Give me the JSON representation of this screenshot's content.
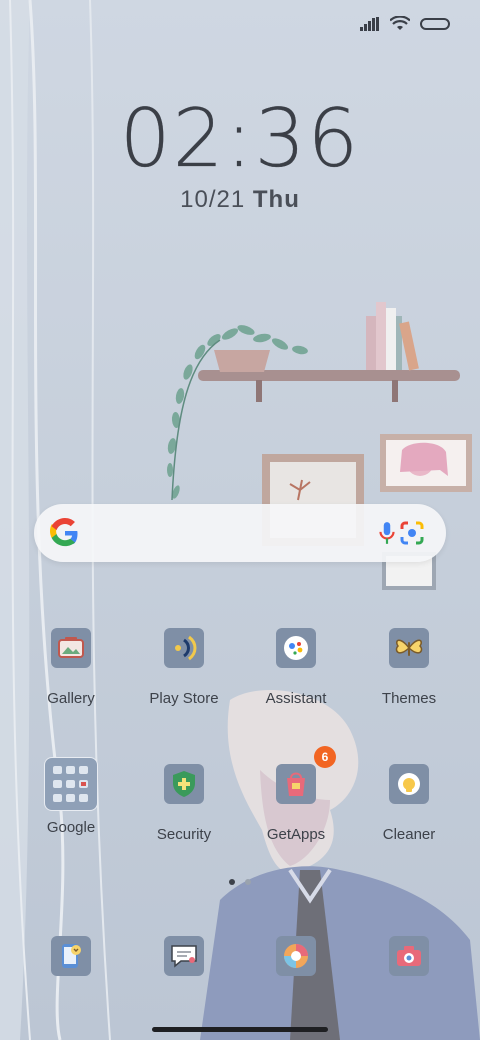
{
  "status_bar": {
    "icons": [
      "signal-icon",
      "wifi-icon",
      "battery-icon"
    ]
  },
  "clock": {
    "hours": "02",
    "separator": ":",
    "minutes": "36"
  },
  "date": {
    "day": "10/21",
    "weekday": "Thu"
  },
  "search": {
    "icons": [
      "google-icon",
      "mic-icon",
      "lens-icon"
    ]
  },
  "apps": [
    {
      "label": "Gallery",
      "icon": "gallery-icon"
    },
    {
      "label": "Play Store",
      "icon": "play-store-icon"
    },
    {
      "label": "Assistant",
      "icon": "assistant-icon"
    },
    {
      "label": "Themes",
      "icon": "themes-icon"
    },
    {
      "label": "Google",
      "icon": "google-folder-icon"
    },
    {
      "label": "Security",
      "icon": "security-icon"
    },
    {
      "label": "GetApps",
      "icon": "getapps-icon",
      "badge": "6"
    },
    {
      "label": "Cleaner",
      "icon": "cleaner-icon"
    }
  ],
  "dock": [
    {
      "icon": "phone-icon"
    },
    {
      "icon": "messages-icon"
    },
    {
      "icon": "browser-icon"
    },
    {
      "icon": "camera-icon"
    }
  ],
  "page_indicator": {
    "pages": 2,
    "active": 1
  },
  "colors": {
    "background": "#c9d2de",
    "text": "#3d424a",
    "badge": "#f26522",
    "icon_tile": "#7f8fa6"
  }
}
